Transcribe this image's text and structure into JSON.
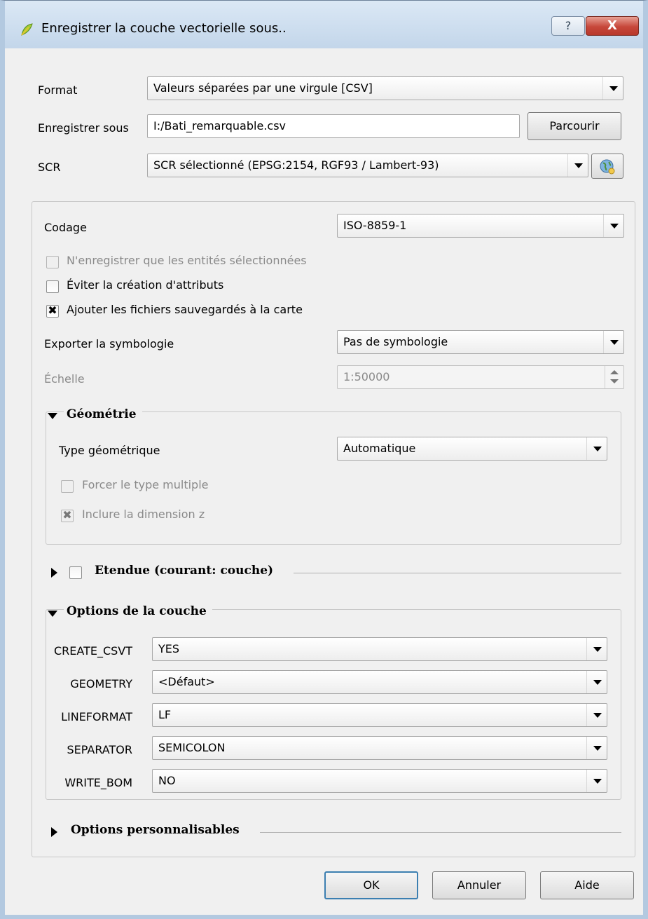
{
  "window": {
    "title": "Enregistrer la couche vectorielle sous..",
    "help_label": "?",
    "close_label": "X"
  },
  "format": {
    "label": "Format",
    "value": "Valeurs séparées par une virgule [CSV]"
  },
  "save_as": {
    "label": "Enregistrer sous",
    "value": "I:/Bati_remarquable.csv",
    "browse_label": "Parcourir"
  },
  "crs": {
    "label": "SCR",
    "value": "SCR sélectionné (EPSG:2154, RGF93 / Lambert-93)"
  },
  "encoding": {
    "label": "Codage",
    "value": "ISO-8859-1"
  },
  "checkboxes": {
    "selected_only": {
      "label": "N'enregistrer que les entités sélectionnées",
      "checked": false,
      "enabled": false
    },
    "skip_attributes": {
      "label": "Éviter la création d'attributs",
      "checked": false,
      "enabled": true
    },
    "add_to_map": {
      "label": "Ajouter les fichiers sauvegardés à la carte",
      "checked": true,
      "enabled": true
    }
  },
  "symbology": {
    "label": "Exporter la symbologie",
    "value": "Pas de symbologie"
  },
  "scale": {
    "label": "Échelle",
    "value": "1:50000"
  },
  "geometry": {
    "title": "Géométrie",
    "type_label": "Type géométrique",
    "type_value": "Automatique",
    "force_multi": {
      "label": "Forcer le type multiple",
      "checked": false
    },
    "include_z": {
      "label": "Inclure la dimension z",
      "checked": true
    }
  },
  "extent": {
    "title": "Etendue (courant: couche)",
    "checked": false
  },
  "layer_options": {
    "title": "Options de la couche",
    "rows": [
      {
        "label": "CREATE_CSVT",
        "value": "YES"
      },
      {
        "label": "GEOMETRY",
        "value": "<Défaut>"
      },
      {
        "label": "LINEFORMAT",
        "value": "LF"
      },
      {
        "label": "SEPARATOR",
        "value": "SEMICOLON"
      },
      {
        "label": "WRITE_BOM",
        "value": "NO"
      }
    ]
  },
  "custom_options": {
    "title": "Options personnalisables"
  },
  "buttons": {
    "ok": "OK",
    "cancel": "Annuler",
    "help": "Aide"
  },
  "icons": {
    "title": "qgis-leaf-icon",
    "crs_selector": "globe-icon"
  },
  "colors": {
    "title_bar": "#c3d6ea",
    "close_button": "#c7473a",
    "default_button_border": "#3c7fb1"
  }
}
